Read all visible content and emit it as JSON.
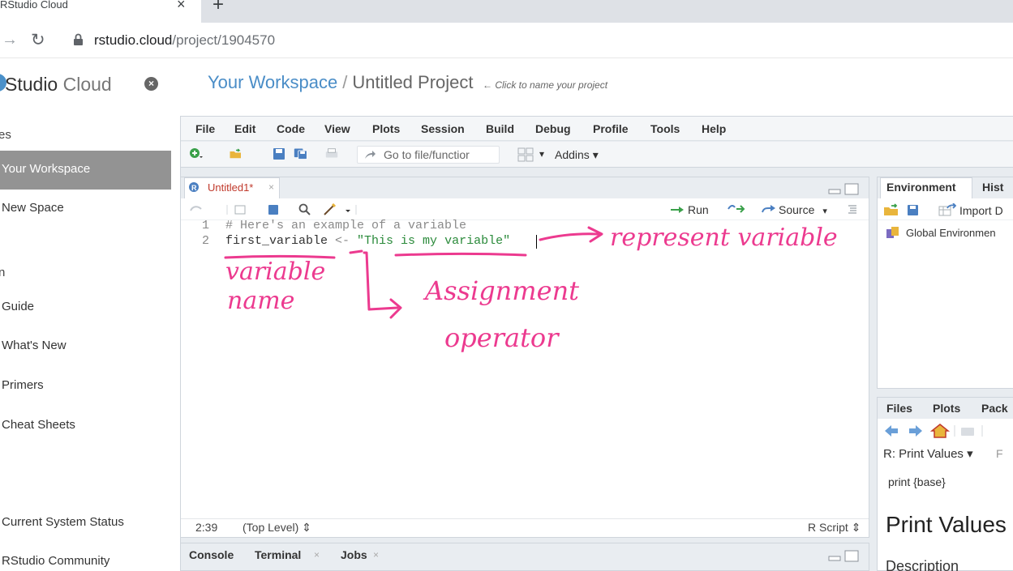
{
  "browser": {
    "tab_title": "RStudio Cloud",
    "tab_close": "×",
    "new_tab": "+",
    "url_host": "rstudio.cloud",
    "url_path": "/project/1904570"
  },
  "sidebar": {
    "brand_main": "Studio",
    "brand_light": " Cloud",
    "close": "×",
    "section_spaces": "es",
    "items": [
      "Your Workspace",
      "New Space"
    ],
    "section_learn": "n",
    "learn_items": [
      "Guide",
      "What's New",
      "Primers",
      "Cheat Sheets"
    ],
    "section_help": "",
    "help_items": [
      "Current System Status",
      "RStudio Community"
    ]
  },
  "header": {
    "workspace": "Your Workspace",
    "separator": "/",
    "project": "Untitled Project",
    "hint": "← Click to name your project"
  },
  "menu": [
    "File",
    "Edit",
    "Code",
    "View",
    "Plots",
    "Session",
    "Build",
    "Debug",
    "Profile",
    "Tools",
    "Help"
  ],
  "toolbar": {
    "goto_placeholder": "Go to file/functior",
    "addins": "Addins ▾"
  },
  "source": {
    "tab_name": "Untitled1*",
    "tab_close": "×",
    "run": "Run",
    "source": "Source",
    "lines": [
      {
        "num": "1",
        "text": "# Here's an example of a variable"
      },
      {
        "num": "2",
        "name": "first_variable",
        "op": " <- ",
        "str": "\"This is my variable\""
      }
    ],
    "cursor_pos": "2:39",
    "scope": "(Top Level) ⇕",
    "file_type": "R Script ⇕"
  },
  "console_tabs": [
    "Console",
    "Terminal",
    "Jobs"
  ],
  "environment": {
    "tabs": [
      "Environment",
      "Hist"
    ],
    "import": "Import D",
    "global": "Global Environmen"
  },
  "files_pane": {
    "tabs": [
      "Files",
      "Plots",
      "Pack"
    ],
    "rprint": "R: Print Values ▾",
    "print_base": "print {base}",
    "title": "Print Values",
    "section": "Description"
  },
  "annotations": {
    "represent": "represent variable",
    "var_name_1": "variable",
    "var_name_2": "name",
    "assign_1": "Assignment",
    "assign_2": "operator"
  },
  "colors": {
    "accent_blue": "#4a8dc7",
    "annotation_pink": "#ec3a8f",
    "string_green": "#2a8a3a",
    "active_sidebar": "#939393"
  }
}
